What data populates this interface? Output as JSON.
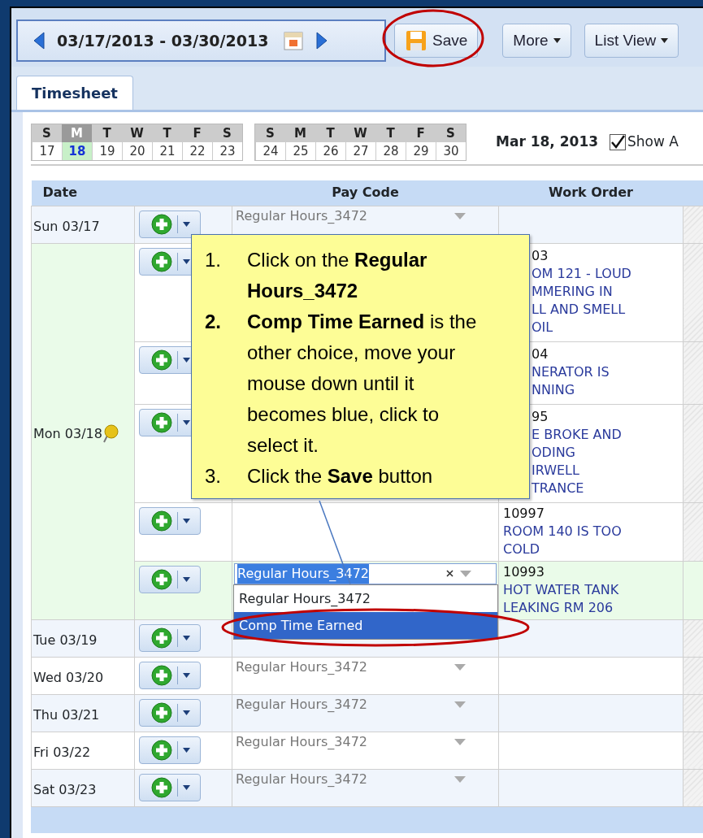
{
  "toolbar": {
    "date_range": "03/17/2013 - 03/30/2013",
    "buttons": [
      {
        "label": "Save",
        "kind": "save",
        "highlighted": true
      },
      {
        "label": "More",
        "kind": "menu",
        "highlighted": false
      },
      {
        "label": "List View",
        "kind": "menu",
        "highlighted": false
      }
    ]
  },
  "tabs": [
    {
      "label": "Timesheet",
      "selected": true
    }
  ],
  "calendar": {
    "weeks": [
      [
        {
          "letter": "S",
          "day": "17",
          "selected": false
        },
        {
          "letter": "M",
          "day": "18",
          "selected": true
        },
        {
          "letter": "T",
          "day": "19",
          "selected": false
        },
        {
          "letter": "W",
          "day": "20",
          "selected": false
        },
        {
          "letter": "T",
          "day": "21",
          "selected": false
        },
        {
          "letter": "F",
          "day": "22",
          "selected": false
        },
        {
          "letter": "S",
          "day": "23",
          "selected": false
        }
      ],
      [
        {
          "letter": "S",
          "day": "24",
          "selected": false
        },
        {
          "letter": "M",
          "day": "25",
          "selected": false
        },
        {
          "letter": "T",
          "day": "26",
          "selected": false
        },
        {
          "letter": "W",
          "day": "27",
          "selected": false
        },
        {
          "letter": "T",
          "day": "28",
          "selected": false
        },
        {
          "letter": "F",
          "day": "29",
          "selected": false
        },
        {
          "letter": "S",
          "day": "30",
          "selected": false
        }
      ]
    ],
    "date_label": "Mar 18, 2013",
    "show_option": {
      "label": "Show A",
      "checked": true
    }
  },
  "table": {
    "columns": [
      "Date",
      "Pay Code",
      "Work Order"
    ],
    "rows": [
      {
        "date": "Sun 03/17",
        "note": false,
        "selected": false,
        "entries": [
          {
            "pay_code": "Regular Hours_3472",
            "selected": false
          }
        ]
      },
      {
        "date": "Mon 03/18",
        "note": true,
        "selected": true,
        "entries": [
          {
            "selected": false,
            "clipped": true,
            "work_order": {
              "number": "03",
              "description": [
                "OM 121 - LOUD",
                "MMERING IN",
                "LL AND SMELL",
                "OIL"
              ]
            }
          },
          {
            "selected": false,
            "clipped": true,
            "work_order": {
              "number": "04",
              "description": [
                "NERATOR IS",
                "NNING"
              ]
            }
          },
          {
            "selected": false,
            "clipped": true,
            "work_order": {
              "number": "95",
              "description": [
                "E BROKE AND",
                "ODING",
                "IRWELL",
                "TRANCE"
              ]
            }
          },
          {
            "selected": false,
            "clipped": false,
            "work_order": {
              "number": "10997",
              "description": [
                "ROOM 140 IS TOO",
                "COLD"
              ]
            }
          },
          {
            "selected": true,
            "clipped": false,
            "editing": true,
            "pay_code": "Regular Hours_3472",
            "work_order": {
              "number": "10993",
              "description": [
                "HOT WATER TANK",
                "LEAKING RM 206"
              ]
            }
          }
        ]
      },
      {
        "date": "Tue 03/19",
        "note": false,
        "selected": false,
        "entries": [
          {
            "selected": false
          }
        ]
      },
      {
        "date": "Wed 03/20",
        "note": false,
        "selected": false,
        "entries": [
          {
            "pay_code": "Regular Hours_3472",
            "selected": false
          }
        ]
      },
      {
        "date": "Thu 03/21",
        "note": false,
        "selected": false,
        "entries": [
          {
            "pay_code": "Regular Hours_3472",
            "selected": false
          }
        ]
      },
      {
        "date": "Fri 03/22",
        "note": false,
        "selected": false,
        "entries": [
          {
            "pay_code": "Regular Hours_3472",
            "selected": false
          }
        ]
      },
      {
        "date": "Sat 03/23",
        "note": false,
        "selected": false,
        "entries": [
          {
            "pay_code": "Regular Hours_3472",
            "selected": false
          }
        ]
      }
    ]
  },
  "dropdown": {
    "options": [
      {
        "label": "Regular Hours_3472",
        "selected": false
      },
      {
        "label": "Comp Time Earned",
        "selected": true
      }
    ]
  },
  "callout": {
    "steps": [
      {
        "number": "1.",
        "text": "Click on the **Regular Hours_3472**"
      },
      {
        "number": "**2.**",
        "text": "**Comp Time Earned** is the other choice, move your mouse down until it becomes blue, click to select it."
      },
      {
        "number": "3.",
        "text": "Click the **Save** button"
      }
    ]
  }
}
